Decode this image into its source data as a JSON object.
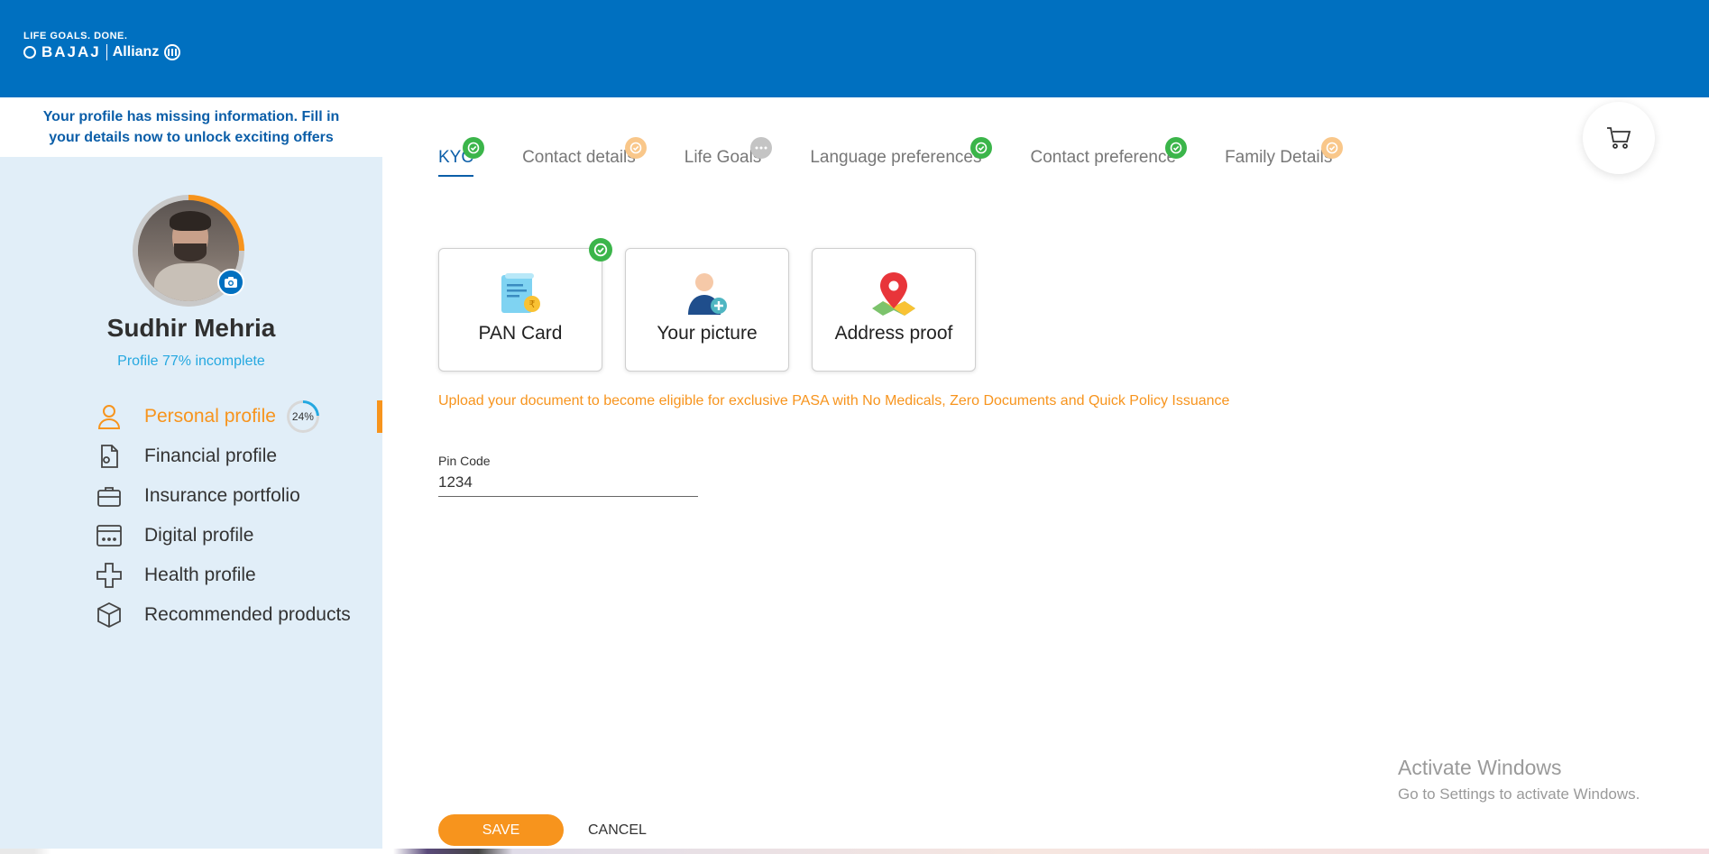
{
  "header": {
    "logo_tagline": "LIFE GOALS. DONE.",
    "logo_brand": "BAJAJ",
    "logo_partner": "Allianz",
    "bg_color": "#0070c0"
  },
  "banner": {
    "text": "Your profile has missing information. Fill in your details now to unlock exciting offers"
  },
  "profile": {
    "name": "Sudhir Mehria",
    "status": "Profile 77% incomplete",
    "ring_progress_percent": 23
  },
  "sidebar": {
    "items": [
      {
        "label": "Personal profile",
        "icon": "person-icon",
        "active": true,
        "badge": "24%"
      },
      {
        "label": "Financial profile",
        "icon": "document-icon",
        "active": false
      },
      {
        "label": "Insurance portfolio",
        "icon": "briefcase-icon",
        "active": false
      },
      {
        "label": "Digital profile",
        "icon": "browser-window-icon",
        "active": false
      },
      {
        "label": "Health profile",
        "icon": "medical-cross-icon",
        "active": false
      },
      {
        "label": "Recommended products",
        "icon": "box-icon",
        "active": false
      }
    ]
  },
  "tabs": [
    {
      "label": "KYC",
      "status": "done",
      "active": true
    },
    {
      "label": "Contact details",
      "status": "pending",
      "active": false
    },
    {
      "label": "Life Goals",
      "status": "more",
      "active": false
    },
    {
      "label": "Language preferences",
      "status": "done",
      "active": false
    },
    {
      "label": "Contact preference",
      "status": "done",
      "active": false
    },
    {
      "label": "Family Details",
      "status": "pending",
      "active": false
    }
  ],
  "documents": [
    {
      "label": "PAN Card",
      "icon": "pan-card-icon",
      "uploaded": true
    },
    {
      "label": "Your picture",
      "icon": "add-user-icon",
      "uploaded": false
    },
    {
      "label": "Address proof",
      "icon": "map-pin-icon",
      "uploaded": false
    }
  ],
  "notice": "Upload your document to become eligible for exclusive PASA with No Medicals, Zero Documents and Quick Policy Issuance",
  "pin_field": {
    "label": "Pin Code",
    "value": "1234"
  },
  "actions": {
    "save_label": "SAVE",
    "cancel_label": "CANCEL"
  },
  "watermark": {
    "line1": "Activate Windows",
    "line2": "Go to Settings to activate Windows."
  },
  "colors": {
    "accent_orange": "#f7941d",
    "brand_blue": "#0070c0",
    "success_green": "#3bb54a",
    "sidebar_bg": "#e1eef8"
  }
}
